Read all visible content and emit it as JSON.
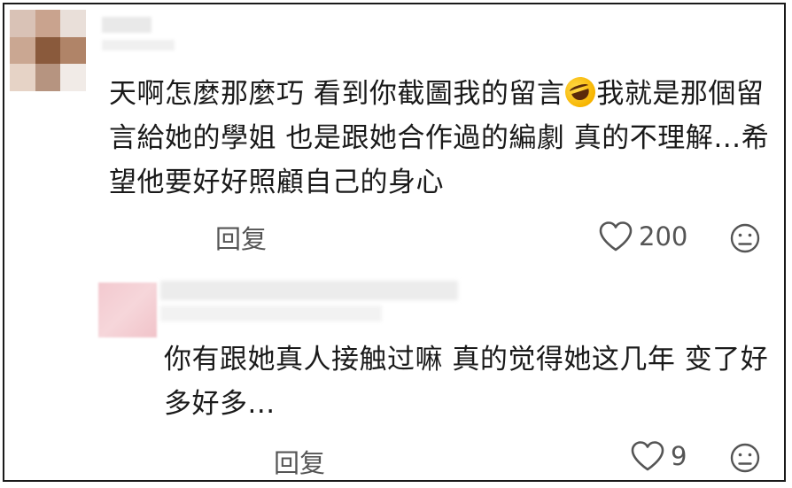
{
  "comments": [
    {
      "text_parts": [
        "天啊怎麼那麼巧 看到你截圖我的留言",
        "我就是那個留言給她的學姐 也是跟她合作過的編劇 真的不理解…希望他要好好照顧自己的身心"
      ],
      "emoji": "rolling-on-floor-laughing-emoji",
      "reply_label": "回复",
      "like_count": "200"
    },
    {
      "text": "你有跟她真人接触过嘛 真的觉得她这几年 变了好多好多...",
      "reply_label": "回复",
      "like_count": "9"
    }
  ],
  "colors": {
    "text": "#1a1a1a",
    "meta": "#555555",
    "border": "#1a1a1a",
    "avatar_blur_pink": "#f3c9cf"
  },
  "icons": {
    "like": "heart-outline-icon",
    "dislike": "frown-face-icon"
  }
}
